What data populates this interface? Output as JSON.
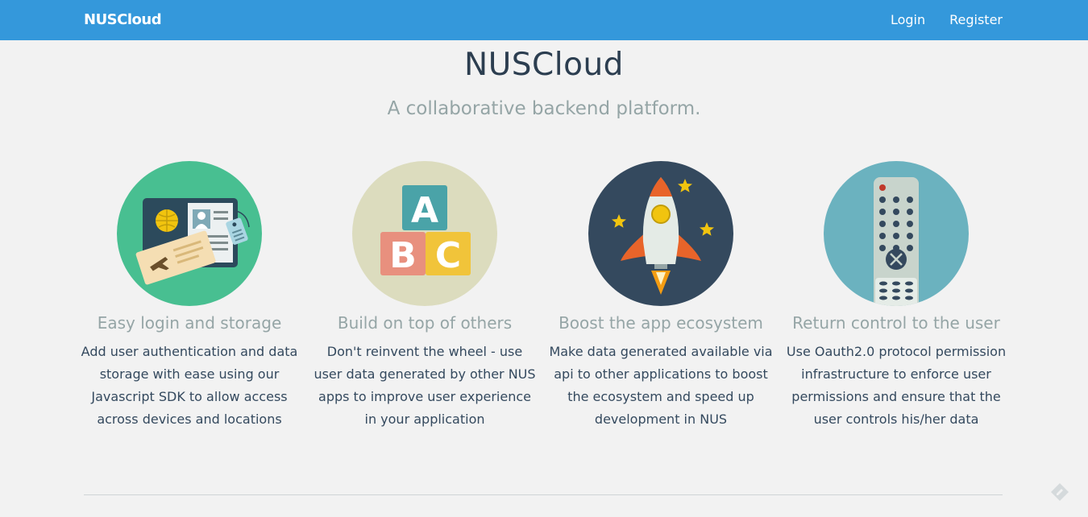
{
  "nav": {
    "brand": "NUSCloud",
    "login": "Login",
    "register": "Register"
  },
  "hero": {
    "title": "NUSCloud",
    "subtitle": "A collaborative backend platform."
  },
  "features": [
    {
      "title": "Easy login and storage",
      "desc": [
        "Add user authentication and data",
        "storage with ease using our",
        "Javascript SDK to allow access",
        "across devices and locations"
      ],
      "icon": "passport-icon",
      "color": "#48bf91"
    },
    {
      "title": "Build on top of others",
      "desc": [
        "Don't reinvent the wheel - use",
        "user data generated by other NUS",
        "apps to improve user experience",
        "in your application"
      ],
      "icon": "abc-blocks-icon",
      "color": "#dcdcbe"
    },
    {
      "title": "Boost the app ecosystem",
      "desc": [
        "Make data generated available via",
        "api to other applications to boost",
        "the ecosystem and speed up",
        "development in NUS"
      ],
      "icon": "rocket-icon",
      "color": "#34495e"
    },
    {
      "title": "Return control to the user",
      "desc": [
        "Use Oauth2.0 protocol permission",
        "infrastructure to enforce user",
        "permissions and ensure that the",
        "user controls his/her data"
      ],
      "icon": "remote-control-icon",
      "color": "#6bb2bf"
    }
  ],
  "blocks": {
    "a": "A",
    "b": "B",
    "c": "C"
  }
}
